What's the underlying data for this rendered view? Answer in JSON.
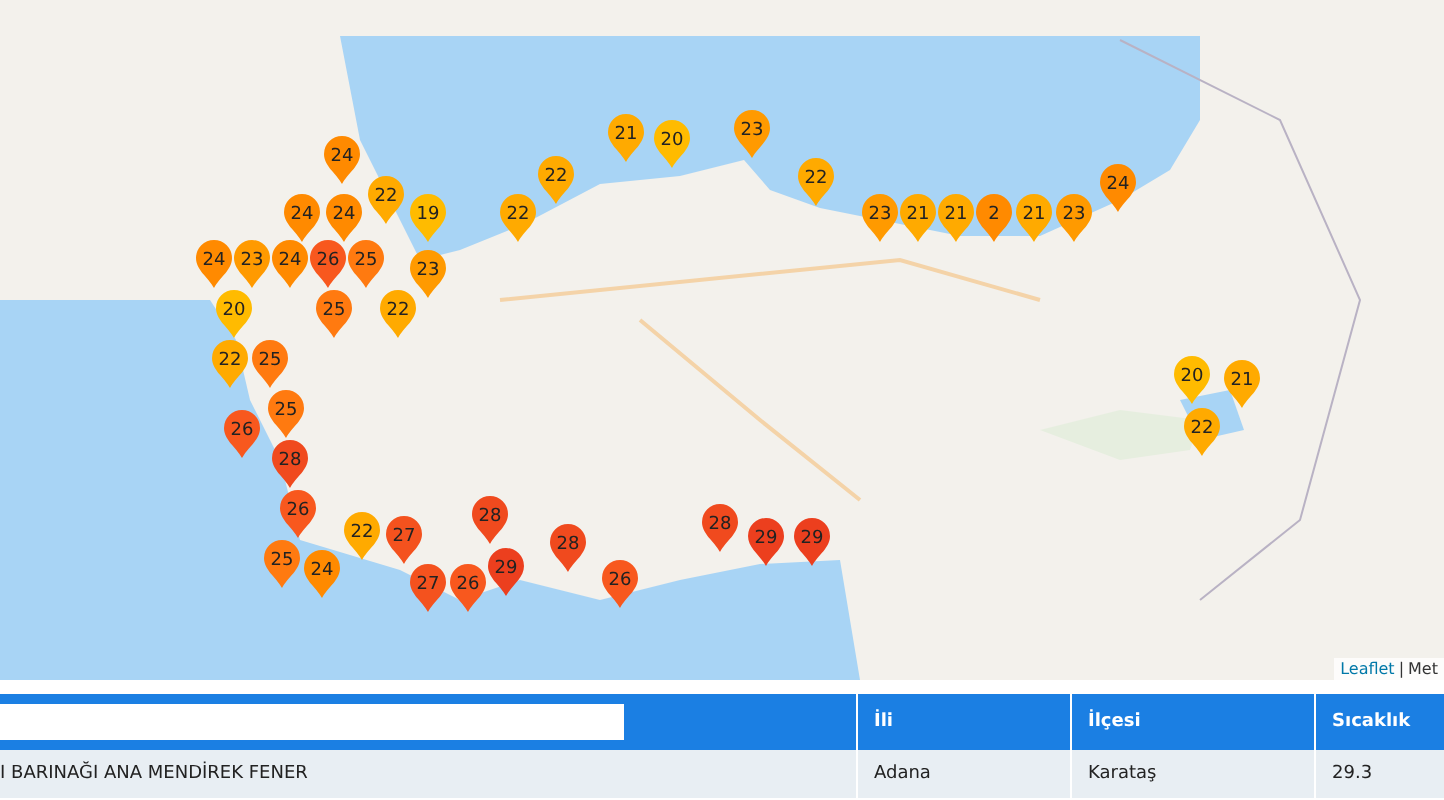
{
  "map": {
    "markers": [
      {
        "value": "23",
        "color": "#ff9a00"
      },
      {
        "value": "21",
        "color": "#ffaa00"
      },
      {
        "value": "20",
        "color": "#ffbb00"
      },
      {
        "value": "24",
        "color": "#ff8a00"
      },
      {
        "value": "22",
        "color": "#ffaa00"
      },
      {
        "value": "22",
        "color": "#ffaa00"
      },
      {
        "value": "24",
        "color": "#ff8a00"
      },
      {
        "value": "22",
        "color": "#ffaa00"
      },
      {
        "value": "24",
        "color": "#ff8a00"
      },
      {
        "value": "24",
        "color": "#ff8a00"
      },
      {
        "value": "19",
        "color": "#ffbb00"
      },
      {
        "value": "22",
        "color": "#ffaa00"
      },
      {
        "value": "23",
        "color": "#ff9a00"
      },
      {
        "value": "21",
        "color": "#ffaa00"
      },
      {
        "value": "21",
        "color": "#ffaa00"
      },
      {
        "value": "2",
        "color": "#ff8a00"
      },
      {
        "value": "21",
        "color": "#ffaa00"
      },
      {
        "value": "23",
        "color": "#ff9a00"
      },
      {
        "value": "24",
        "color": "#ff8a00"
      },
      {
        "value": "23",
        "color": "#ff9a00"
      },
      {
        "value": "24",
        "color": "#ff8a00"
      },
      {
        "value": "26",
        "color": "#f8581e"
      },
      {
        "value": "25",
        "color": "#ff7a10"
      },
      {
        "value": "23",
        "color": "#ff9a00"
      },
      {
        "value": "20",
        "color": "#ffbb00"
      },
      {
        "value": "25",
        "color": "#ff7a10"
      },
      {
        "value": "22",
        "color": "#ffaa00"
      },
      {
        "value": "22",
        "color": "#ffaa00"
      },
      {
        "value": "25",
        "color": "#ff7a10"
      },
      {
        "value": "20",
        "color": "#ffbb00"
      },
      {
        "value": "21",
        "color": "#ffaa00"
      },
      {
        "value": "25",
        "color": "#ff7a10"
      },
      {
        "value": "22",
        "color": "#ffaa00"
      },
      {
        "value": "26",
        "color": "#f8581e"
      },
      {
        "value": "28",
        "color": "#f04a1e"
      },
      {
        "value": "26",
        "color": "#f8581e"
      },
      {
        "value": "28",
        "color": "#f04a1e"
      },
      {
        "value": "28",
        "color": "#f04a1e"
      },
      {
        "value": "22",
        "color": "#ffaa00"
      },
      {
        "value": "27",
        "color": "#f4521e"
      },
      {
        "value": "29",
        "color": "#ec3f1e"
      },
      {
        "value": "29",
        "color": "#ec3f1e"
      },
      {
        "value": "28",
        "color": "#f04a1e"
      },
      {
        "value": "25",
        "color": "#ff7a10"
      },
      {
        "value": "24",
        "color": "#ff8a00"
      },
      {
        "value": "27",
        "color": "#f4521e"
      },
      {
        "value": "26",
        "color": "#f8581e"
      },
      {
        "value": "29",
        "color": "#ec3f1e"
      },
      {
        "value": "26",
        "color": "#f8581e"
      }
    ],
    "attribution": {
      "link": "Leaflet",
      "separator": "|",
      "source": "Met"
    }
  },
  "table": {
    "columns": [
      {
        "kind": "filter"
      },
      {
        "kind": "label",
        "label": "İli"
      },
      {
        "kind": "label",
        "label": "İlçesi"
      },
      {
        "kind": "label",
        "label": "Sıcaklık"
      }
    ],
    "rows": [
      {
        "cells": [
          "I BARINAĞI ANA MENDİREK FENER",
          "Adana",
          "Karataş",
          "29.3"
        ]
      }
    ]
  }
}
